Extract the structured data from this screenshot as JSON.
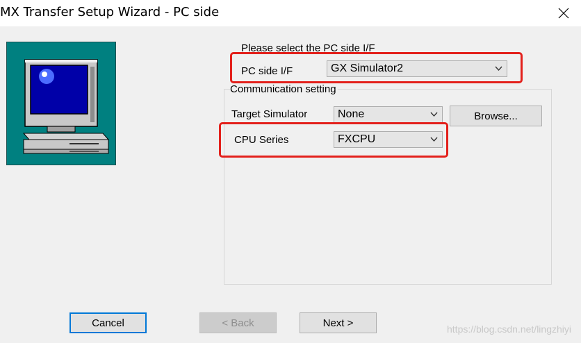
{
  "window": {
    "title": "MX Transfer Setup Wizard - PC side",
    "close_icon": "close-icon"
  },
  "wizard_image": {
    "icon": "computer-icon",
    "background": "#008080"
  },
  "pc_side": {
    "heading": "Please select the PC side I/F",
    "label": "PC side I/F",
    "value": "GX Simulator2"
  },
  "communication": {
    "group_label": "Communication setting",
    "target_simulator": {
      "label": "Target Simulator",
      "value": "None"
    },
    "browse_label": "Browse...",
    "cpu_series": {
      "label": "CPU Series",
      "value": "FXCPU"
    }
  },
  "buttons": {
    "cancel": "Cancel",
    "back": "< Back",
    "next": "Next >"
  },
  "annotation": {
    "color": "#e3201b"
  },
  "watermark": "https://blog.csdn.net/lingzhiyi"
}
